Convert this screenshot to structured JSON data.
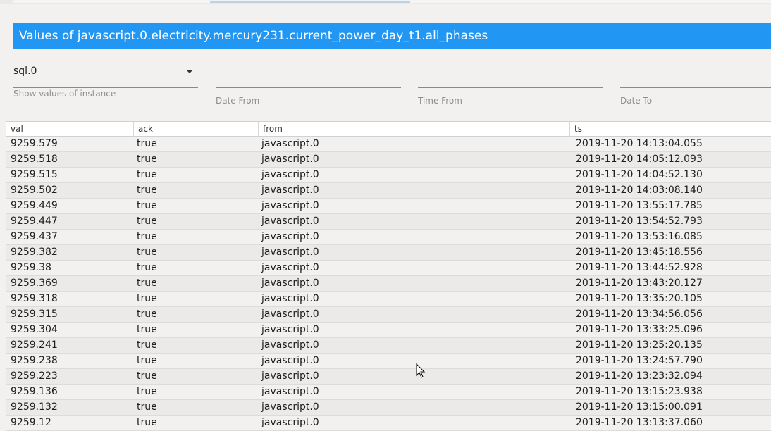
{
  "title": "Values of javascript.0.electricity.mercury231.current_power_day_t1.all_phases",
  "instance": {
    "value": "sql.0",
    "label": "Show values of instance"
  },
  "filters": [
    {
      "label": "Date From",
      "value": ""
    },
    {
      "label": "Time From",
      "value": ""
    },
    {
      "label": "Date To",
      "value": ""
    }
  ],
  "table": {
    "columns": [
      "val",
      "ack",
      "from",
      "ts"
    ],
    "rows": [
      [
        "9259.579",
        "true",
        "javascript.0",
        "2019-11-20 14:13:04.055"
      ],
      [
        "9259.518",
        "true",
        "javascript.0",
        "2019-11-20 14:05:12.093"
      ],
      [
        "9259.515",
        "true",
        "javascript.0",
        "2019-11-20 14:04:52.130"
      ],
      [
        "9259.502",
        "true",
        "javascript.0",
        "2019-11-20 14:03:08.140"
      ],
      [
        "9259.449",
        "true",
        "javascript.0",
        "2019-11-20 13:55:17.785"
      ],
      [
        "9259.447",
        "true",
        "javascript.0",
        "2019-11-20 13:54:52.793"
      ],
      [
        "9259.437",
        "true",
        "javascript.0",
        "2019-11-20 13:53:16.085"
      ],
      [
        "9259.382",
        "true",
        "javascript.0",
        "2019-11-20 13:45:18.556"
      ],
      [
        "9259.38",
        "true",
        "javascript.0",
        "2019-11-20 13:44:52.928"
      ],
      [
        "9259.369",
        "true",
        "javascript.0",
        "2019-11-20 13:43:20.127"
      ],
      [
        "9259.318",
        "true",
        "javascript.0",
        "2019-11-20 13:35:20.105"
      ],
      [
        "9259.315",
        "true",
        "javascript.0",
        "2019-11-20 13:34:56.056"
      ],
      [
        "9259.304",
        "true",
        "javascript.0",
        "2019-11-20 13:33:25.096"
      ],
      [
        "9259.241",
        "true",
        "javascript.0",
        "2019-11-20 13:25:20.135"
      ],
      [
        "9259.238",
        "true",
        "javascript.0",
        "2019-11-20 13:24:57.790"
      ],
      [
        "9259.223",
        "true",
        "javascript.0",
        "2019-11-20 13:23:32.094"
      ],
      [
        "9259.136",
        "true",
        "javascript.0",
        "2019-11-20 13:15:23.938"
      ],
      [
        "9259.132",
        "true",
        "javascript.0",
        "2019-11-20 13:15:00.091"
      ],
      [
        "9259.12",
        "true",
        "javascript.0",
        "2019-11-20 13:13:37.060"
      ]
    ]
  },
  "colors": {
    "accent": "#2196f3",
    "background": "#f3f1ef",
    "row_alt": "#ebeae9"
  },
  "icons": {
    "dropdown": "caret-down-icon",
    "cursor": "mouse-pointer-icon"
  }
}
